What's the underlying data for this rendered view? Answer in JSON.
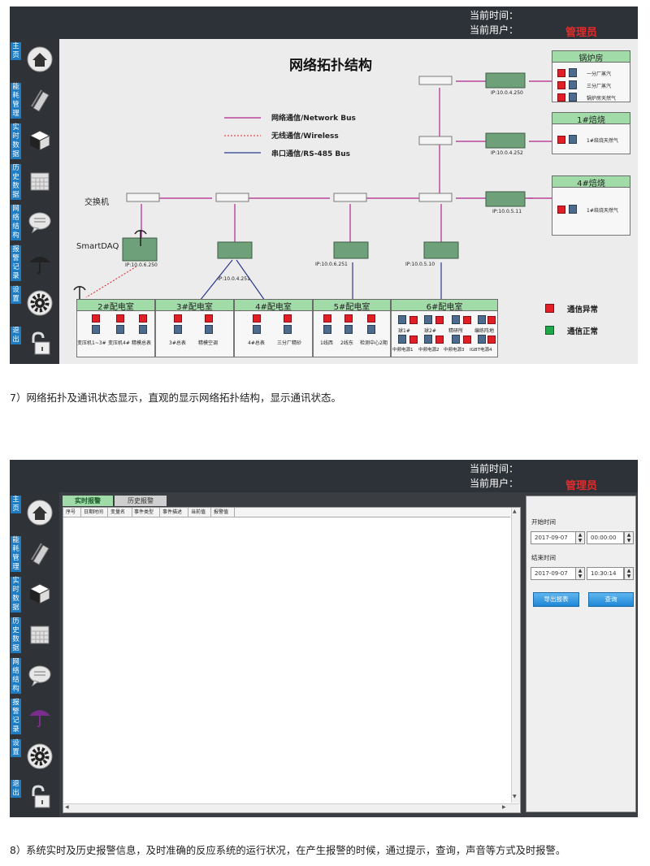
{
  "topbar": {
    "time_label": "当前时间：",
    "user_label": "当前用户：",
    "user_value": "管理员"
  },
  "sidebar": {
    "items": [
      {
        "label": "主页",
        "icon": "home-icon"
      },
      {
        "label": "能耗管理",
        "icon": "book-icon"
      },
      {
        "label": "实时数据",
        "icon": "cube-icon"
      },
      {
        "label": "历史数据",
        "icon": "calendar-icon"
      },
      {
        "label": "网络结构",
        "icon": "chat-icon"
      },
      {
        "label": "报警记录",
        "icon": "umbrella-icon"
      },
      {
        "label": "设置",
        "icon": "gear-icon"
      },
      {
        "label": "退出",
        "icon": "exit-icon"
      }
    ]
  },
  "topology": {
    "title": "网络拓扑结构",
    "legend": [
      {
        "label": "网络通信/Network Bus",
        "color": "#b0278c"
      },
      {
        "label": "无线通信/Wireless",
        "color": "#e21e26"
      },
      {
        "label": "串口通信/RS-485 Bus",
        "color": "#2a3b8f"
      }
    ],
    "switch_label": "交换机",
    "daq_label": "SmartDAQ",
    "ips": [
      "IP:10.0.4.250",
      "IP:10.0.4.252",
      "IP:10.0.5.11",
      "IP:10.0.6.250",
      "IP:10.0.4.251",
      "IP:10.0.6.251",
      "IP:10.0.5.10"
    ],
    "right_boxes": [
      {
        "title": "锅炉房",
        "items": [
          "一分厂蒸汽",
          "三分厂蒸汽",
          "锅炉房天然气"
        ]
      },
      {
        "title": "1#焙烧",
        "items": [
          "1#焙烧天然气"
        ]
      },
      {
        "title": "4#焙烧",
        "items": [
          "1#焙烧天然气"
        ]
      }
    ],
    "rooms": [
      {
        "title": "2#配电室",
        "items": [
          "变压机1~3#",
          "变压机4#",
          "精模总表"
        ]
      },
      {
        "title": "3#配电室",
        "items": [
          "3#总表",
          "精模空调"
        ]
      },
      {
        "title": "4#配电室",
        "items": [
          "4#总表",
          "三分厂精砂"
        ]
      },
      {
        "title": "5#配电室",
        "items": [
          "1线西",
          "2线东",
          "检测中心2期"
        ]
      },
      {
        "title": "6#配电室",
        "items": [
          "球1#",
          "球2#",
          "精研所",
          "编练阵地",
          "中频电源1",
          "中频电源2",
          "中频电源3",
          "IGBT电源4"
        ]
      }
    ],
    "status_legend": [
      {
        "label": "通信异常",
        "color": "#e21e26"
      },
      {
        "label": "通信正常",
        "color": "#1fa84a"
      }
    ]
  },
  "caption1": "7）网络拓扑及通讯状态显示，直观的显示网络拓扑结构，显示通讯状态。",
  "alarm": {
    "tabs": [
      "实时报警",
      "历史报警"
    ],
    "columns": [
      "序号",
      "日期时间",
      "变量名",
      "事件类型",
      "事件描述",
      "当前值",
      "报警值"
    ],
    "start_label": "开始时间",
    "start_date": "2017-09-07",
    "start_time": "00:00:00",
    "end_label": "结束时间",
    "end_date": "2017-09-07",
    "end_time": "10:30:14",
    "export_label": "导出报表",
    "query_label": "查询"
  },
  "caption2": "8）系统实时及历史报警信息，及时准确的反应系统的运行状况，在产生报警的时候，通过提示，查询，声音等方式及时报警。"
}
